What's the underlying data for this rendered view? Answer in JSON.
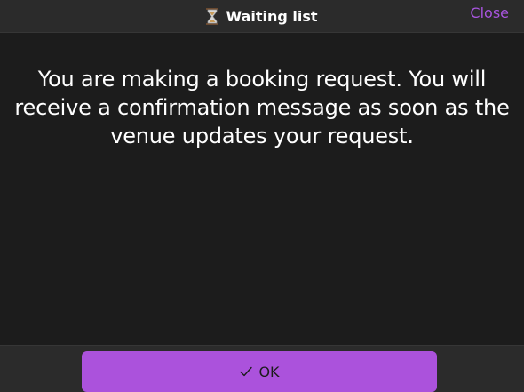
{
  "header": {
    "title": "Waiting list",
    "close_label": "Close",
    "icon": "hourglass-icon"
  },
  "body": {
    "message": "You are making a booking request. You will receive a confirmation message as soon as the venue updates your request."
  },
  "footer": {
    "ok_label": "OK",
    "ok_icon": "check-icon"
  },
  "colors": {
    "background": "#1c1c1c",
    "header_background": "#2b2b2b",
    "accent": "#ab52dc",
    "close_text": "#a855df",
    "text": "#ffffff"
  }
}
